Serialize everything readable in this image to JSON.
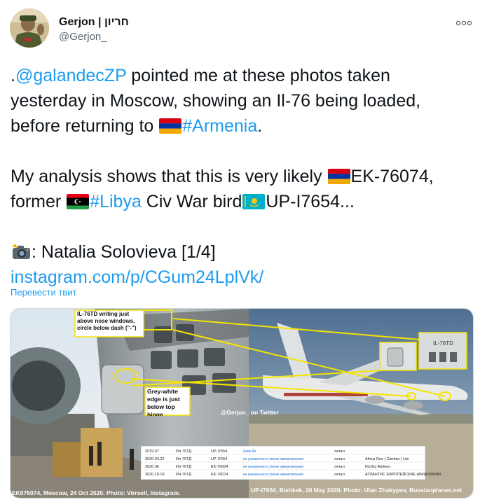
{
  "author": {
    "display_name": "Gerjon | חריון",
    "handle": "@Gerjon_"
  },
  "more_label": "∘∘∘",
  "tweet": {
    "line1_mention": "@galandecZP",
    "line1_prefix": ".",
    "line1_rest": " pointed me at these photos taken",
    "line2": "yesterday in Moscow, showing an Il-76 being loaded,",
    "line3_pre": "before returning to ",
    "line3_hashtag": "#Armenia",
    "line3_post": ".",
    "line4_pre": "My analysis shows that this is very likely ",
    "line4_post": "EK-76074,",
    "line5_pre": "former ",
    "line5_hashtag": "#Libya",
    "line5_mid": " Civ War bird",
    "line5_post": "UP-I7654...",
    "line6": ": Natalia Solovieva [1/4]",
    "link": "instagram.com/p/CGum24LplVk/"
  },
  "translate_label": "Перевести твит",
  "media": {
    "annotation_writing": "IL-76TD writing just above nose windows, circle below dash (\"-\")",
    "annotation_edge": "Grey-white edge is just below top hinge",
    "inset_label": "IL-76TD",
    "watermark": "@Gerjon_ on Twitter",
    "caption_left": "EK076074, Moscow, 24 Oct 2020. Photo: Virraell, Instagram.",
    "caption_right": "UP-I7654, Bishkek, 20 May 2020. Photo: Ulan Zhakypov, Russianplanes.net",
    "table": {
      "rows": [
        [
          "2019.07",
          "Ил-76ТД",
          "UP-I7654",
          "Azee Air",
          "летал",
          ""
        ],
        [
          "2020.04.22",
          "Ил-76ТД",
          "UP-I7654",
          "не указанная в списке авиакомпания",
          "летал",
          "Africa One ( Zambia ) Ltd."
        ],
        [
          "2020.06",
          "Ил-76ТД",
          "EK-76004",
          "не указанная в списке авиакомпания",
          "летал",
          "FlySky Airlines"
        ],
        [
          "2020.10.19",
          "Ил-76ТД",
          "EK-76074",
          "не указанная в списке авиакомпания",
          "летал",
          "АТЛАНТИС ЕВРОПЕЙСКИЕ АВИАЛИНИИ"
        ]
      ]
    }
  },
  "colors": {
    "link": "#1d9bf0",
    "text": "#0f1419",
    "secondary": "#536471",
    "annotation": "#f5e400"
  }
}
